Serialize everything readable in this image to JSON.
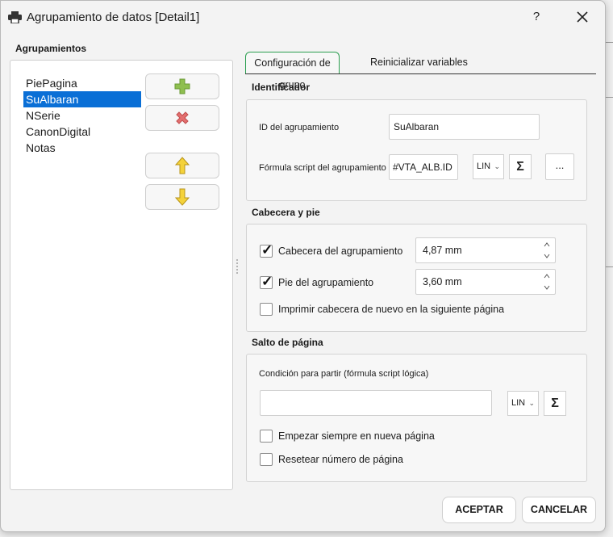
{
  "window": {
    "title": "Agrupamiento de datos [Detail1]",
    "help_label": "?"
  },
  "left": {
    "section_label": "Agrupamientos",
    "groups": [
      "PiePagina",
      "SuAlbaran",
      "NSerie",
      "CanonDigital",
      "Notas"
    ],
    "selected_index": 1,
    "buttons": [
      "add-icon",
      "delete-icon",
      "arrow-up-icon",
      "arrow-down-icon"
    ]
  },
  "tabs": {
    "active": "Configuración de grupo",
    "inactive": "Reinicializar variables"
  },
  "identificador": {
    "title": "Identificador",
    "id_label": "ID del agrupamiento",
    "id_value": "SuAlbaran",
    "formula_label": "Fórmula script del agrupamiento",
    "formula_value": "#VTA_ALB.ID",
    "lang_value": "LIN",
    "sigma": "Σ",
    "more": "..."
  },
  "cabecera": {
    "title": "Cabecera y pie",
    "header_label": "Cabecera del agrupamiento",
    "header_checked": true,
    "header_value": "4,87 mm",
    "footer_label": "Pie del agrupamiento",
    "footer_checked": true,
    "footer_value": "3,60 mm",
    "reprint_label": "Imprimir cabecera de nuevo en la siguiente página",
    "reprint_checked": false
  },
  "salto": {
    "title": "Salto de página",
    "condition_label": "Condición para partir (fórmula script lógica)",
    "condition_value": "",
    "lang_value": "LIN",
    "sigma": "Σ",
    "new_page_label": "Empezar siempre en nueva página",
    "new_page_checked": false,
    "reset_label": "Resetear número de página",
    "reset_checked": false
  },
  "footer": {
    "accept": "ACEPTAR",
    "cancel": "CANCELAR"
  },
  "colors": {
    "selection": "#0a6fd6",
    "active_tab_border": "#2c9e50",
    "add_icon": "#8fbf50",
    "delete_icon": "#e36f6f",
    "arrow_icon": "#f4d23a"
  }
}
